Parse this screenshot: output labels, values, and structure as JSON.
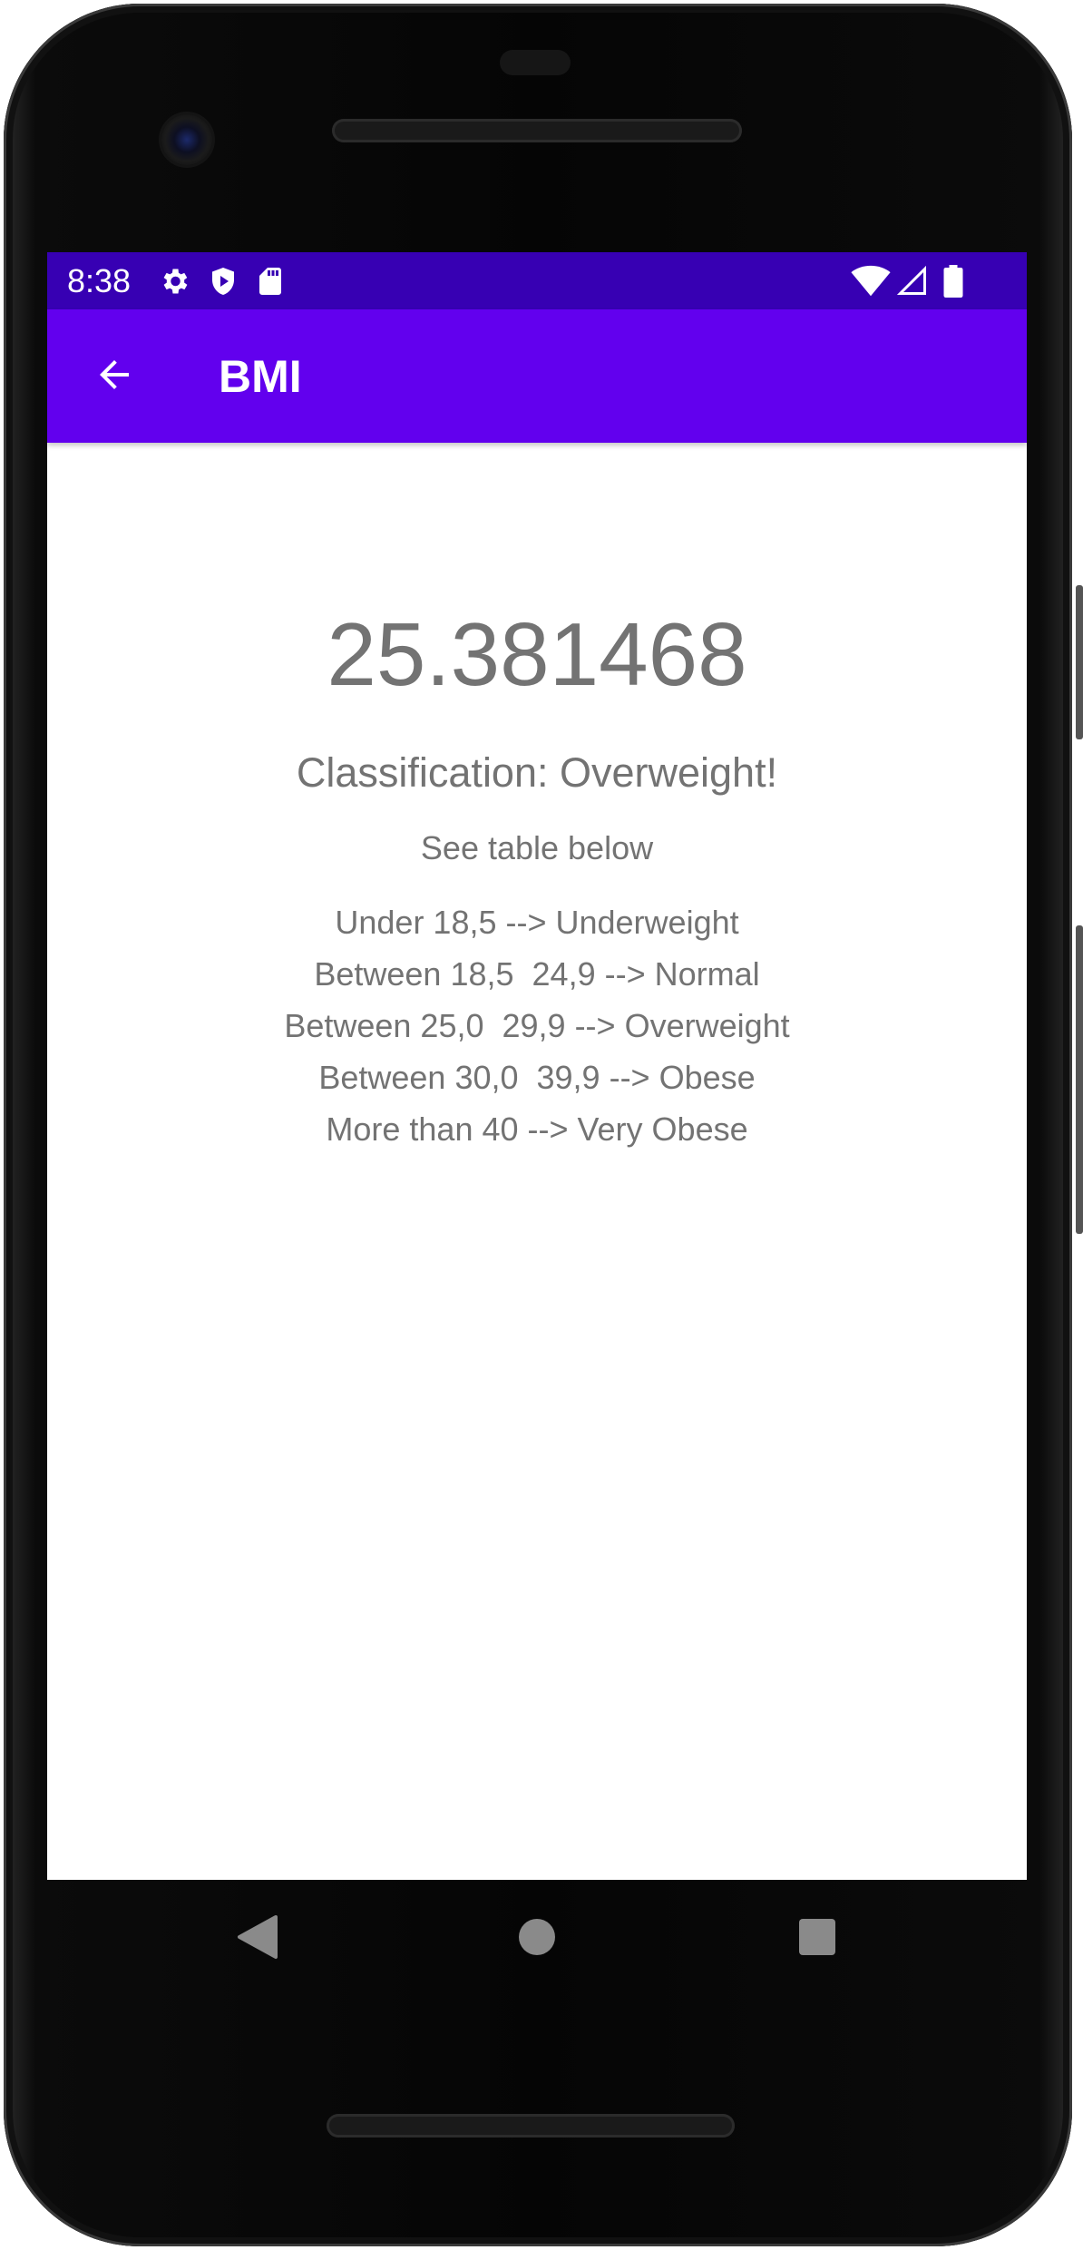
{
  "status_bar": {
    "time": "8:38",
    "left_icons": [
      "gear-icon",
      "shield-icon",
      "sd-card-icon"
    ],
    "right_icons": [
      "wifi-icon",
      "cell-signal-icon",
      "battery-icon"
    ],
    "background_color": "#3700B3"
  },
  "app_bar": {
    "title": "BMI",
    "back_icon": "arrow-back-icon",
    "background_color": "#6200EE"
  },
  "main": {
    "bmi_value": "25.381468",
    "classification": "Classification: Overweight!",
    "hint": "See table below",
    "table": [
      "Under 18,5 --> Underweight",
      "Between 18,5  24,9 --> Normal",
      "Between 25,0  29,9 --> Overweight",
      "Between 30,0  39,9 --> Obese",
      "More than 40 --> Very Obese"
    ],
    "text_color": "#737373"
  },
  "navigation": {
    "buttons": [
      "nav-back-icon",
      "nav-home-icon",
      "nav-recents-icon"
    ]
  }
}
